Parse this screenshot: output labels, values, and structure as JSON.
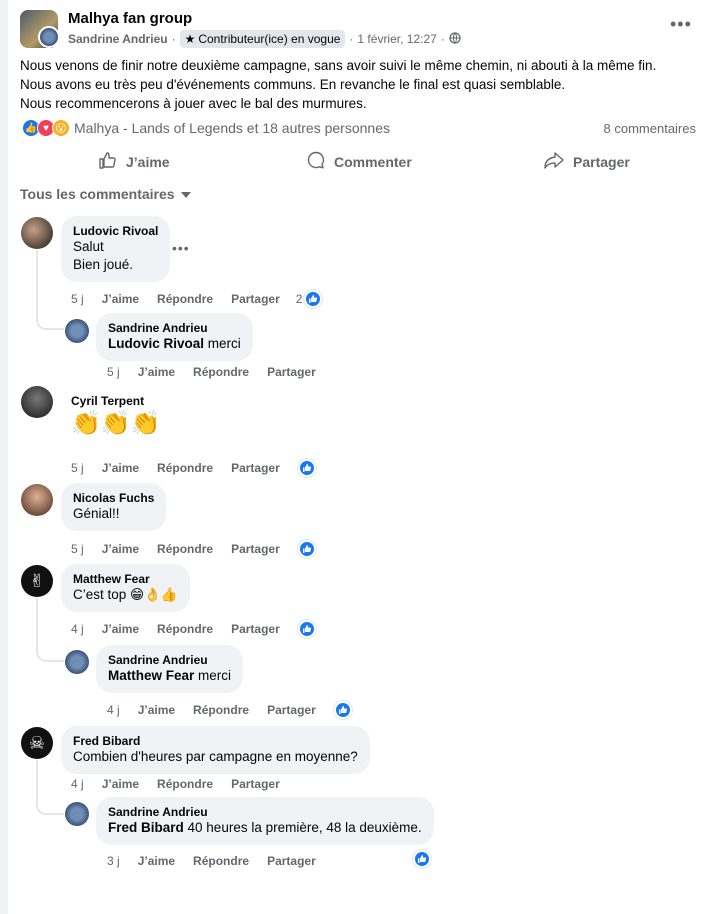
{
  "post": {
    "group_name": "Malhya fan group",
    "author": "Sandrine Andrieu",
    "badge": "Contributeur(ice) en vogue",
    "timestamp": "1 février, 12:27",
    "text_lines": [
      "Nous venons de finir notre deuxième campagne, sans avoir suivi le même chemin, ni abouti à la même fin.",
      "Nous avons eu très peu d'événements communs. En revanche le final est quasi semblable.",
      "Nous recommencerons à jouer avec le bal des murmures."
    ],
    "reactions_text": "Malhya - Lands of Legends et 18 autres personnes",
    "comment_count": "8 commentaires",
    "actions": {
      "like": "J’aime",
      "comment": "Commenter",
      "share": "Partager"
    }
  },
  "sort_label": "Tous les commentaires",
  "labels": {
    "like": "J’aime",
    "reply": "Répondre",
    "share": "Partager"
  },
  "comments": [
    {
      "author": "Ludovic Rivoal",
      "lines": [
        "Salut",
        "Bien joué."
      ],
      "time": "5 j",
      "likes": "2"
    },
    {
      "author": "Sandrine Andrieu",
      "mention": "Ludovic Rivoal",
      "text": "merci",
      "time": "5 j"
    },
    {
      "author": "Cyril Terpent",
      "text": "👏👏👏",
      "time": "5 j"
    },
    {
      "author": "Nicolas Fuchs",
      "text": "Génial!!",
      "time": "5 j"
    },
    {
      "author": "Matthew Fear",
      "text": "C’est top 😁👌👍",
      "time": "4 j"
    },
    {
      "author": "Sandrine Andrieu",
      "mention": "Matthew Fear",
      "text": "merci",
      "time": "4 j"
    },
    {
      "author": "Fred Bibard",
      "text": "Combien d'heures par campagne en moyenne?",
      "time": "4 j"
    },
    {
      "author": "Sandrine Andrieu",
      "mention": "Fred Bibard",
      "text": "40 heures la première, 48 la deuxième.",
      "time": "3 j"
    }
  ]
}
